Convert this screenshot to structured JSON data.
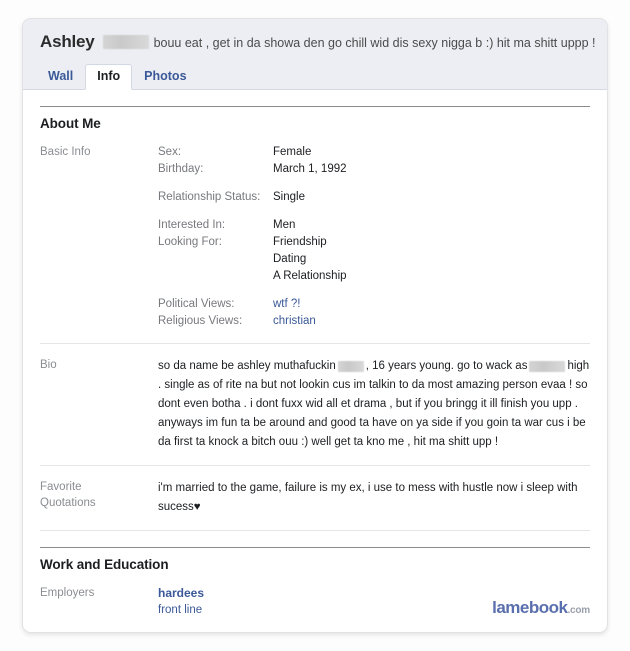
{
  "profile": {
    "name": "Ashley",
    "name_redacted": true,
    "status_text": "bouu eat , get in da showa den go chill wid dis sexy nigga b :) hit ma shitt uppp !"
  },
  "tabs": [
    {
      "label": "Wall",
      "active": false
    },
    {
      "label": "Info",
      "active": true
    },
    {
      "label": "Photos",
      "active": false
    }
  ],
  "sections": {
    "about_me": {
      "heading": "About Me",
      "basic_info": {
        "label": "Basic Info",
        "group1": [
          {
            "key": "Sex:",
            "value": "Female"
          },
          {
            "key": "Birthday:",
            "value": "March 1, 1992"
          }
        ],
        "group2": [
          {
            "key": "Relationship Status:",
            "value": "Single"
          }
        ],
        "group3": [
          {
            "key": "Interested In:",
            "value": "Men"
          },
          {
            "key": "Looking For:",
            "value": "Friendship"
          }
        ],
        "group3_extra": [
          "Dating",
          "A Relationship"
        ],
        "group4": [
          {
            "key": "Political Views:",
            "value": "wtf ?!",
            "is_link": true
          },
          {
            "key": "Religious Views:",
            "value": "christian",
            "is_link": true
          }
        ]
      },
      "bio": {
        "label": "Bio",
        "part1": "so da name be ashley muthafuckin",
        "part2": ", 16 years young. go to wack as",
        "part3": "high . single as of rite na but not lookin cus im talkin to da most amazing person evaa ! so dont even botha . i dont fuxx wid all et drama , but if you bringg it ill finish you upp . anyways im fun ta be around and good ta have on ya side if you goin ta war cus i be da first ta knock a bitch ouu :) well get ta kno me , hit ma shitt upp !"
      },
      "favorite_quotations": {
        "label_line1": "Favorite",
        "label_line2": "Quotations",
        "text": "i'm married to the game, failure is my ex, i use to mess with hustle now i sleep with sucess♥"
      }
    },
    "work_education": {
      "heading": "Work and Education",
      "employers": {
        "label": "Employers",
        "name": "hardees",
        "position": "front line"
      }
    }
  },
  "watermark": {
    "brand": "lamebook",
    "tld": ".com"
  },
  "colors": {
    "link_blue": "#3b5998",
    "header_band": "#eceef4",
    "label_gray": "#8a8d91",
    "watermark_blue": "#5a6fad"
  }
}
